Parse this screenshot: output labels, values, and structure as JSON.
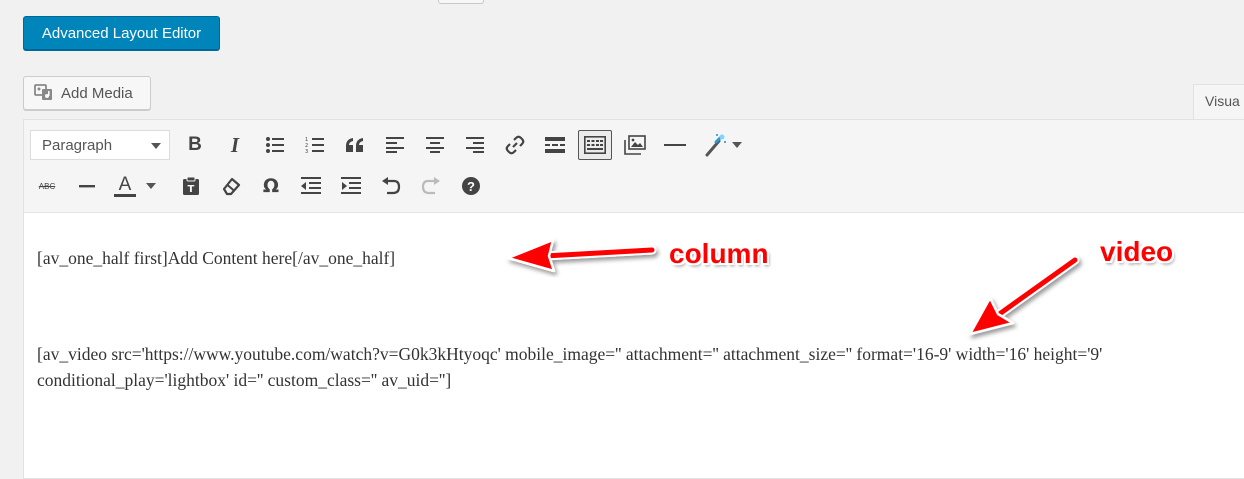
{
  "header": {
    "advanced_layout_editor_label": "Advanced Layout Editor",
    "add_media_label": "Add Media",
    "visual_tab_label": "Visua"
  },
  "toolbar": {
    "format_select_value": "Paragraph",
    "row1": [
      "bold-icon",
      "italic-icon",
      "bullet-list-icon",
      "numbered-list-icon",
      "blockquote-icon",
      "align-left-icon",
      "align-center-icon",
      "align-right-icon",
      "link-icon",
      "read-more-icon",
      "toolbar-toggle-icon",
      "gallery-icon",
      "horizontal-line-icon",
      "magic-wand-icon"
    ],
    "row2": [
      "strikethrough-icon",
      "horizontal-rule-icon",
      "text-color-icon",
      "paste-text-icon",
      "clear-formatting-icon",
      "omega-icon",
      "outdent-icon",
      "indent-icon",
      "undo-icon",
      "redo-icon",
      "help-icon"
    ],
    "bold_glyph": "B",
    "italic_glyph": "I",
    "strike_glyph": "ABC",
    "text_color_glyph": "A",
    "omega_glyph": "Ω",
    "help_glyph": "?",
    "colors": {
      "toolbar_bg": "#f5f5f5",
      "icon": "#444444",
      "primary_button": "#0085ba"
    }
  },
  "editor": {
    "line1": "[av_one_half first]Add Content here[/av_one_half]",
    "line2": "[av_video src='https://www.youtube.com/watch?v=G0k3kHtyoqc' mobile_image='' attachment='' attachment_size='' format='16-9' width='16' height='9' conditional_play='lightbox' id='' custom_class='' av_uid='']"
  },
  "annotations": {
    "column_label": "column",
    "video_label": "video",
    "color": "#ff0000"
  }
}
